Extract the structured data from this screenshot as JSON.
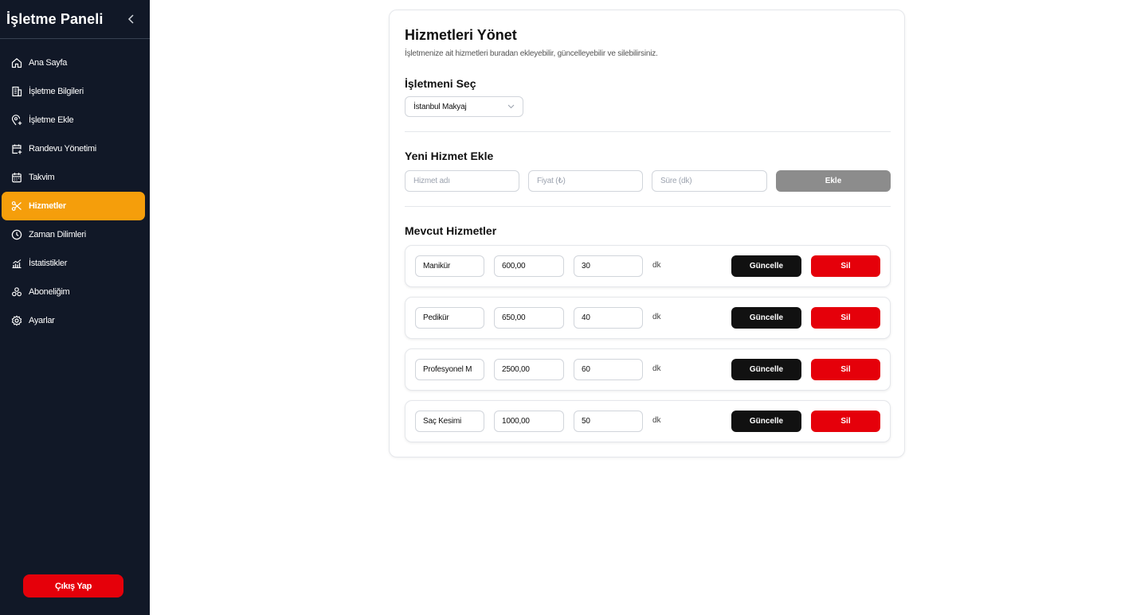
{
  "sidebar": {
    "title": "İşletme Paneli",
    "items": [
      {
        "label": "Ana Sayfa",
        "icon": "home-icon"
      },
      {
        "label": "İşletme Bilgileri",
        "icon": "building-icon"
      },
      {
        "label": "İşletme Ekle",
        "icon": "map-pin-plus-icon"
      },
      {
        "label": "Randevu Yönetimi",
        "icon": "calendar-plus-icon"
      },
      {
        "label": "Takvim",
        "icon": "calendar-icon"
      },
      {
        "label": "Hizmetler",
        "icon": "scissors-icon",
        "active": true
      },
      {
        "label": "Zaman Dilimleri",
        "icon": "clock-icon"
      },
      {
        "label": "İstatistikler",
        "icon": "chart-icon"
      },
      {
        "label": "Aboneliğim",
        "icon": "subscription-icon"
      },
      {
        "label": "Ayarlar",
        "icon": "gear-icon"
      }
    ],
    "logout_label": "Çıkış Yap"
  },
  "page": {
    "title": "Hizmetleri Yönet",
    "subtitle": "İşletmenize ait hizmetleri buradan ekleyebilir, güncelleyebilir ve silebilirsiniz."
  },
  "business_select": {
    "section_title": "İşletmeni Seç",
    "selected": "İstanbul Makyaj"
  },
  "new_service": {
    "section_title": "Yeni Hizmet Ekle",
    "name_placeholder": "Hizmet adı",
    "price_placeholder": "Fiyat (₺)",
    "duration_placeholder": "Süre (dk)",
    "add_label": "Ekle"
  },
  "services": {
    "section_title": "Mevcut Hizmetler",
    "unit": "dk",
    "update_label": "Güncelle",
    "delete_label": "Sil",
    "rows": [
      {
        "name": "Manikür",
        "price": "600,00",
        "duration": "30"
      },
      {
        "name": "Pedikür",
        "price": "650,00",
        "duration": "40"
      },
      {
        "name": "Profesyonel M",
        "price": "2500,00",
        "duration": "60"
      },
      {
        "name": "Saç Kesimi",
        "price": "1000,00",
        "duration": "50"
      }
    ]
  },
  "colors": {
    "sidebar_bg": "#111827",
    "active_item": "#f59e0b",
    "danger": "#e5000a",
    "dark_button": "#111111",
    "disabled_button": "#8c8c8c"
  }
}
